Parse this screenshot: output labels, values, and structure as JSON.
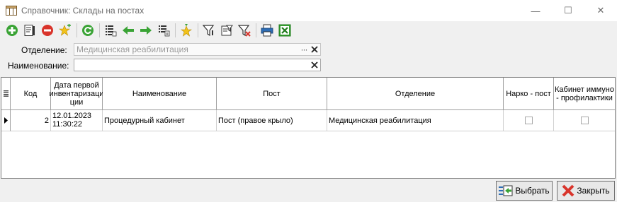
{
  "window": {
    "title": "Справочник: Склады на постах",
    "minimize_glyph": "—",
    "maximize_glyph": "☐",
    "close_glyph": "✕"
  },
  "toolbar": {
    "icons": [
      "add-icon",
      "edit-icon",
      "delete-icon",
      "add-favorite-icon",
      "refresh-icon",
      "list-settings-icon",
      "arrow-left-icon",
      "arrow-right-icon",
      "list-export-icon",
      "favorites-icon",
      "filter-icon",
      "filter-edit-icon",
      "filter-clear-icon",
      "print-icon",
      "excel-icon"
    ]
  },
  "filters": {
    "department_label": "Отделение:",
    "department_value": "Медицинская реабилитация",
    "department_dots": "···",
    "name_label": "Наименование:",
    "name_value": ""
  },
  "table": {
    "columns": [
      "Код",
      "Дата первой инвентаризации",
      "Наименование",
      "Пост",
      "Отделение",
      "Нарко - пост",
      "Кабинет иммуно - профилактики"
    ],
    "column_display": {
      "date": [
        "Дата первой",
        "инвентаризаци",
        "ции"
      ],
      "cabinet": [
        "Кабинет иммуно",
        "- профилактики"
      ]
    },
    "rows": [
      {
        "code": "2",
        "date_line1": "12.01.2023",
        "date_line2": "11:30:22",
        "name": "Процедурный кабинет",
        "post": "Пост (правое крыло)",
        "department": "Медицинская реабилитация",
        "narco_post": false,
        "immuno_cabinet": false
      }
    ]
  },
  "buttons": {
    "select_label": "Выбрать",
    "close_label": "Закрыть"
  },
  "colors": {
    "green": "#3aa335",
    "red": "#d9342b",
    "yellow": "#f2c21b",
    "blue": "#2e6db5"
  }
}
